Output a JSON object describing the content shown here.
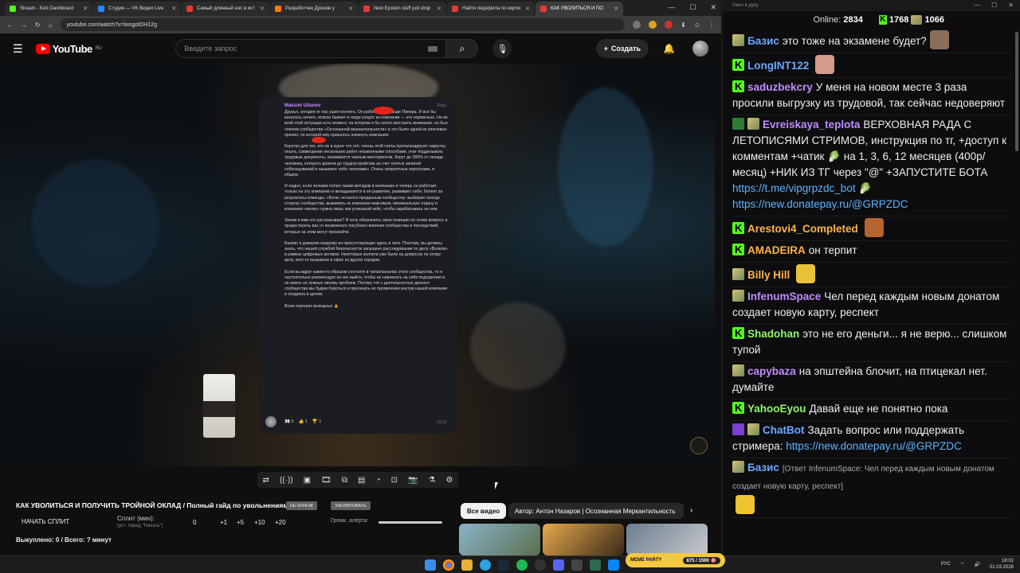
{
  "browser": {
    "tabs": [
      {
        "title": "Stream - Kick Dashboard",
        "fav": "kick"
      },
      {
        "title": "Студия — VK Видео Live",
        "fav": "vk"
      },
      {
        "title": "Самый длинный нос в ист",
        "fav": "yt"
      },
      {
        "title": "Разработчик Дронов у",
        "fav": "orange"
      },
      {
        "title": "New Epstein stuff just drop",
        "fav": "yt"
      },
      {
        "title": "Найти педофила по кирпи",
        "fav": "yt"
      },
      {
        "title": "КАК УВОЛИТЬСЯ И ПО",
        "fav": "yt"
      }
    ],
    "url": "youtube.com/watch?v=lwsgotDH12g"
  },
  "youtube": {
    "logo_text": "YouTube",
    "logo_region": "RU",
    "search_placeholder": "Введите запрос",
    "create_label": "Создать"
  },
  "post": {
    "author": "Maksim Ulianov",
    "reply": "Reply",
    "paragraphs": [
      "Друзья, сегодня от нас ушел коллега. Он работал в команде Пиеера. И все бы казалось ничего, всякое бывает и люди уходят из компании — это нормально. Но во всей этой ситуации есть момент, на котором я бы хотел заострить внимание: он был членом сообщества «Осознанной меркантильности» и это было одной из ключевых причин, по которой ему пришлось покинуть компанию.",
      "Коротко для тех, кто не в курсе что это: члены этой секты пропагандируют накрутку опыта, совмещение нескольких работ незаконными способами, учат подделывать трудовые документы, занимаются черным менторингом, берут до 300% от оклада человека, которого довели до трудоустройства за счет снятых записей собеседований и называют себя «волками». Очень неприятные персонажи, в общем.",
      "И ладно, если человек попал таким методом в компанию и теперь он работает только на эту компанию и вкладывается в ее развитие, развивает себя, болеет за результаты команды. «Волк» остается преданным сообществу: выбирает всегда сторону сообщества, выжимать из компании максимум, минимальную отдачу и компания «волку» нужна лишь как успешный кейс, чтобы зарабатывать на нем.",
      "Зачем я вам это рассказываю? Я хочу обозначить свою позицию по этому вопросу и предостеречь вас от возможного пагубного влияния сообщества и последствий, которые за этим могут произойти.",
      "Базово я доверяю каждому из присутствующих здесь в чате. Поэтому, вы должны знать, что нашей службой безопасности запущено расследование по делу «Волков» в рамках цифровых активов. Некоторые коллеги уже были на допросах по этому делу, кого-то вызывали в офис из других городов.",
      "Если вы вдруг каким-то образом состоите в чатах/каналах этого сообщества, то я настоятельно рекомендую из них выйти, чтобы не навлекать на себя подозрения и не иметь не нужных никому проблем. Потому что с деятельностью данного сообщества мы будем бороться и пресекать ее проявление внутри нашей компании и холдинга в целом.",
      "Всем хороших выходных 🙏"
    ],
    "reactions": [
      "👀 3",
      "👍 1",
      "🏆 1"
    ],
    "time": "21:51"
  },
  "video": {
    "title": "КАК УВОЛИТЬСЯ И ПОЛУЧИТЬ ТРОЙНОЙ ОКЛАД / Полный гайд по увольнениям",
    "tag1": "НЕ КРИНЖ",
    "tag2": "ЗАКЛИПОВАТЬ"
  },
  "split": {
    "start": "НАЧАТЬ СПЛИТ",
    "label": "Сплит (мин):",
    "hint": "(уст. перед \"Начать\")",
    "value": "0",
    "incs": [
      "+1",
      "+5",
      "+10",
      "+20"
    ],
    "alert_label": "Громк. алерта:",
    "bought": "Выкуплено: 0 / Всего: ? минут"
  },
  "related": {
    "chip_all": "Все видео",
    "chip_author": "Автор: Антон Назаров | Осознанная Меркантильность"
  },
  "chat": {
    "window_title": "Окно в дуку",
    "online_label": "Online:",
    "online": "2834",
    "kick_count": "1768",
    "other_count": "1066",
    "messages": [
      {
        "nick": "Базис",
        "color": "#6aa7ff",
        "badges": [
          "dolph"
        ],
        "text": "это тоже на экзамене будет?",
        "emote": "#8a6f5a"
      },
      {
        "nick": "LongINT122",
        "color": "#6aa7ff",
        "badges": [
          "kick"
        ],
        "text": "",
        "emote": "#d49a8c"
      },
      {
        "nick": "saduzbekcry",
        "color": "#c08cff",
        "badges": [
          "kick"
        ],
        "text": "У меня на новом месте 3 раза просили выгрузку из трудовой, так сейчас недоверяют"
      },
      {
        "nick": "Evreiskaya_teplota",
        "color": "#c08cff",
        "badges": [
          "check",
          "dolph"
        ],
        "text": "ВЕРХОВНАЯ РАДА С ЛЕТОПИСЯМИ СТРИМОВ, инструкция по тг, +доступ к комментам +чатик 🥬 на 1, 3, 6, 12 месяцев (400р/месяц) +НИК ИЗ ТГ через \"@\" +ЗАПУСТИТЕ БОТА ",
        "link": "https://t.me/vipgrpzdc_bot",
        "text2": " 🥬 ",
        "link2": "https://new.donatepay.ru/@GRPZDC"
      },
      {
        "nick": "Arestovi4_Completed",
        "color": "#ffb347",
        "badges": [
          "kick"
        ],
        "text": "",
        "emote": "#b5652f"
      },
      {
        "nick": "AMADEIRA",
        "color": "#ffb347",
        "badges": [
          "kick"
        ],
        "text": "он терпит"
      },
      {
        "nick": "Billy Hill",
        "color": "#ffb347",
        "badges": [
          "dolph"
        ],
        "text": "",
        "emote": "#e8c33a"
      },
      {
        "nick": "InfenumSpace",
        "color": "#c08cff",
        "badges": [
          "dolph"
        ],
        "text": "Чел перед каждым новым донатом создает новую карту, респект"
      },
      {
        "nick": "Shadohan",
        "color": "#8ef56b",
        "badges": [
          "kick"
        ],
        "text": "это не его деньги... я не верю... слишком тупой"
      },
      {
        "nick": "capybaza",
        "color": "#c08cff",
        "badges": [
          "dolph"
        ],
        "text": "на эпштейна блочит, на птицекал нет. думайте"
      },
      {
        "nick": "YahooEyou",
        "color": "#8ef56b",
        "badges": [
          "kick"
        ],
        "text": "Давай еще не понятно пока"
      },
      {
        "nick": "ChatBot",
        "color": "#6aa7ff",
        "badges": [
          "alien",
          "dolph"
        ],
        "text": "Задать вопрос или поддержать стримера: ",
        "link": "https://new.donatepay.ru/@GRPZDC"
      },
      {
        "nick": "Базис",
        "color": "#6aa7ff",
        "badges": [
          "dolph"
        ],
        "reply": "[Ответ InfenumSpace: Чел перед каждым новым донатом создает новую карту, респект]",
        "text": "",
        "emote": "#f0c330"
      }
    ]
  },
  "taskbar": {
    "meme_label": "MEME PARTY",
    "meme_progress": "875 / 1590 🎯",
    "lang": "РУС",
    "time": "18:02",
    "date": "01.03.2026"
  }
}
